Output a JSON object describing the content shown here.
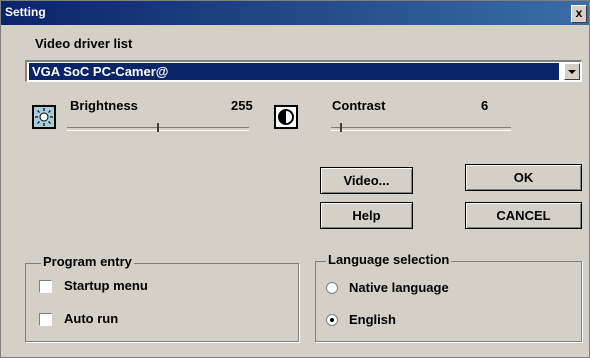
{
  "window": {
    "title": "Setting",
    "close_glyph": "x"
  },
  "video_driver": {
    "label": "Video driver list",
    "selected": "VGA SoC PC-Camer@"
  },
  "brightness": {
    "label": "Brightness",
    "value": "255",
    "icon": "sun-icon",
    "slider_fraction": 0.5
  },
  "contrast": {
    "label": "Contrast",
    "value": "6",
    "icon": "contrast-icon",
    "slider_fraction": 0.05
  },
  "buttons": {
    "video": "Video...",
    "ok": "OK",
    "help": "Help",
    "cancel": "CANCEL"
  },
  "program_entry": {
    "legend": "Program entry",
    "options": [
      {
        "label": "Startup menu",
        "checked": false
      },
      {
        "label": "Auto run",
        "checked": false
      }
    ]
  },
  "language": {
    "legend": "Language selection",
    "options": [
      {
        "label": "Native language",
        "selected": false
      },
      {
        "label": "English",
        "selected": true
      }
    ]
  },
  "colors": {
    "titlebar": "#0a246a",
    "face": "#d4d0c8",
    "selection": "#0a246a"
  }
}
